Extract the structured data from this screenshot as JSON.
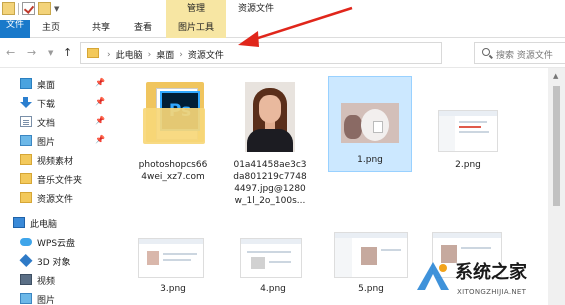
{
  "titlebar": {
    "manage_tab": "管理",
    "window_title": "资源文件"
  },
  "ribbon": {
    "tabs": [
      "文件",
      "主页",
      "共享",
      "查看",
      "图片工具"
    ]
  },
  "address": {
    "crumbs": [
      "此电脑",
      "桌面",
      "资源文件"
    ],
    "search_placeholder": "搜索 资源文件"
  },
  "sidebar": {
    "quick_access": [
      {
        "label": "桌面",
        "icon": "desktop-icon",
        "pinned": true
      },
      {
        "label": "下载",
        "icon": "download-icon",
        "pinned": true
      },
      {
        "label": "文档",
        "icon": "documents-icon",
        "pinned": true
      },
      {
        "label": "图片",
        "icon": "pictures-icon",
        "pinned": true
      },
      {
        "label": "视频素材",
        "icon": "folder-icon",
        "pinned": false
      },
      {
        "label": "音乐文件夹",
        "icon": "folder-icon",
        "pinned": false
      },
      {
        "label": "资源文件",
        "icon": "folder-icon",
        "pinned": false
      }
    ],
    "this_pc": {
      "label": "此电脑",
      "icon": "computer-icon"
    },
    "pc_items": [
      {
        "label": "WPS云盘",
        "icon": "cloud-icon"
      },
      {
        "label": "3D 对象",
        "icon": "3d-objects-icon"
      },
      {
        "label": "视频",
        "icon": "video-icon"
      },
      {
        "label": "图片",
        "icon": "pictures-icon"
      }
    ]
  },
  "files": [
    {
      "name_lines": [
        "photoshopcs66",
        "4wei_xz7.com"
      ],
      "kind": "folder"
    },
    {
      "name_lines": [
        "01a41458ae3c3",
        "da801219c7748",
        "4497.jpg@1280",
        "w_1l_2o_100s..."
      ],
      "kind": "image"
    },
    {
      "name_lines": [
        "1.png"
      ],
      "kind": "image",
      "selected": true
    },
    {
      "name_lines": [
        "2.png"
      ],
      "kind": "image"
    },
    {
      "name_lines": [
        "3.png"
      ],
      "kind": "image"
    },
    {
      "name_lines": [
        "4.png"
      ],
      "kind": "image"
    },
    {
      "name_lines": [
        "5.png"
      ],
      "kind": "image"
    }
  ],
  "watermark": {
    "title": "系统之家",
    "url": "XITONGZHIJIA.NET"
  },
  "colors": {
    "file_tab": "#1979ca",
    "tool_tab": "#f7e6a3",
    "selection": "#cce8ff",
    "annotation_arrow": "#e0261b"
  }
}
